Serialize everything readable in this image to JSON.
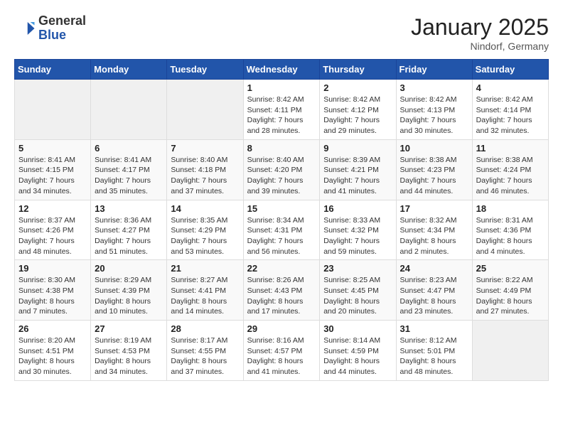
{
  "header": {
    "logo_general": "General",
    "logo_blue": "Blue",
    "month_title": "January 2025",
    "location": "Nindorf, Germany"
  },
  "weekdays": [
    "Sunday",
    "Monday",
    "Tuesday",
    "Wednesday",
    "Thursday",
    "Friday",
    "Saturday"
  ],
  "weeks": [
    [
      {
        "day": "",
        "info": ""
      },
      {
        "day": "",
        "info": ""
      },
      {
        "day": "",
        "info": ""
      },
      {
        "day": "1",
        "info": "Sunrise: 8:42 AM\nSunset: 4:11 PM\nDaylight: 7 hours\nand 28 minutes."
      },
      {
        "day": "2",
        "info": "Sunrise: 8:42 AM\nSunset: 4:12 PM\nDaylight: 7 hours\nand 29 minutes."
      },
      {
        "day": "3",
        "info": "Sunrise: 8:42 AM\nSunset: 4:13 PM\nDaylight: 7 hours\nand 30 minutes."
      },
      {
        "day": "4",
        "info": "Sunrise: 8:42 AM\nSunset: 4:14 PM\nDaylight: 7 hours\nand 32 minutes."
      }
    ],
    [
      {
        "day": "5",
        "info": "Sunrise: 8:41 AM\nSunset: 4:15 PM\nDaylight: 7 hours\nand 34 minutes."
      },
      {
        "day": "6",
        "info": "Sunrise: 8:41 AM\nSunset: 4:17 PM\nDaylight: 7 hours\nand 35 minutes."
      },
      {
        "day": "7",
        "info": "Sunrise: 8:40 AM\nSunset: 4:18 PM\nDaylight: 7 hours\nand 37 minutes."
      },
      {
        "day": "8",
        "info": "Sunrise: 8:40 AM\nSunset: 4:20 PM\nDaylight: 7 hours\nand 39 minutes."
      },
      {
        "day": "9",
        "info": "Sunrise: 8:39 AM\nSunset: 4:21 PM\nDaylight: 7 hours\nand 41 minutes."
      },
      {
        "day": "10",
        "info": "Sunrise: 8:38 AM\nSunset: 4:23 PM\nDaylight: 7 hours\nand 44 minutes."
      },
      {
        "day": "11",
        "info": "Sunrise: 8:38 AM\nSunset: 4:24 PM\nDaylight: 7 hours\nand 46 minutes."
      }
    ],
    [
      {
        "day": "12",
        "info": "Sunrise: 8:37 AM\nSunset: 4:26 PM\nDaylight: 7 hours\nand 48 minutes."
      },
      {
        "day": "13",
        "info": "Sunrise: 8:36 AM\nSunset: 4:27 PM\nDaylight: 7 hours\nand 51 minutes."
      },
      {
        "day": "14",
        "info": "Sunrise: 8:35 AM\nSunset: 4:29 PM\nDaylight: 7 hours\nand 53 minutes."
      },
      {
        "day": "15",
        "info": "Sunrise: 8:34 AM\nSunset: 4:31 PM\nDaylight: 7 hours\nand 56 minutes."
      },
      {
        "day": "16",
        "info": "Sunrise: 8:33 AM\nSunset: 4:32 PM\nDaylight: 7 hours\nand 59 minutes."
      },
      {
        "day": "17",
        "info": "Sunrise: 8:32 AM\nSunset: 4:34 PM\nDaylight: 8 hours\nand 2 minutes."
      },
      {
        "day": "18",
        "info": "Sunrise: 8:31 AM\nSunset: 4:36 PM\nDaylight: 8 hours\nand 4 minutes."
      }
    ],
    [
      {
        "day": "19",
        "info": "Sunrise: 8:30 AM\nSunset: 4:38 PM\nDaylight: 8 hours\nand 7 minutes."
      },
      {
        "day": "20",
        "info": "Sunrise: 8:29 AM\nSunset: 4:39 PM\nDaylight: 8 hours\nand 10 minutes."
      },
      {
        "day": "21",
        "info": "Sunrise: 8:27 AM\nSunset: 4:41 PM\nDaylight: 8 hours\nand 14 minutes."
      },
      {
        "day": "22",
        "info": "Sunrise: 8:26 AM\nSunset: 4:43 PM\nDaylight: 8 hours\nand 17 minutes."
      },
      {
        "day": "23",
        "info": "Sunrise: 8:25 AM\nSunset: 4:45 PM\nDaylight: 8 hours\nand 20 minutes."
      },
      {
        "day": "24",
        "info": "Sunrise: 8:23 AM\nSunset: 4:47 PM\nDaylight: 8 hours\nand 23 minutes."
      },
      {
        "day": "25",
        "info": "Sunrise: 8:22 AM\nSunset: 4:49 PM\nDaylight: 8 hours\nand 27 minutes."
      }
    ],
    [
      {
        "day": "26",
        "info": "Sunrise: 8:20 AM\nSunset: 4:51 PM\nDaylight: 8 hours\nand 30 minutes."
      },
      {
        "day": "27",
        "info": "Sunrise: 8:19 AM\nSunset: 4:53 PM\nDaylight: 8 hours\nand 34 minutes."
      },
      {
        "day": "28",
        "info": "Sunrise: 8:17 AM\nSunset: 4:55 PM\nDaylight: 8 hours\nand 37 minutes."
      },
      {
        "day": "29",
        "info": "Sunrise: 8:16 AM\nSunset: 4:57 PM\nDaylight: 8 hours\nand 41 minutes."
      },
      {
        "day": "30",
        "info": "Sunrise: 8:14 AM\nSunset: 4:59 PM\nDaylight: 8 hours\nand 44 minutes."
      },
      {
        "day": "31",
        "info": "Sunrise: 8:12 AM\nSunset: 5:01 PM\nDaylight: 8 hours\nand 48 minutes."
      },
      {
        "day": "",
        "info": ""
      }
    ]
  ]
}
